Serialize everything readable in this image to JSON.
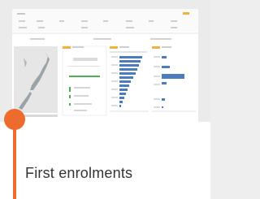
{
  "card": {
    "title": "First enrolments"
  },
  "thumbnail": {
    "label": "dashboard-preview"
  },
  "colors": {
    "accent": "#ec6b2d",
    "bar_blue": "#4a7cbf",
    "bar_green": "#4caf50",
    "map_land": "#9aa3a8",
    "map_bg": "#e6e6e6"
  }
}
